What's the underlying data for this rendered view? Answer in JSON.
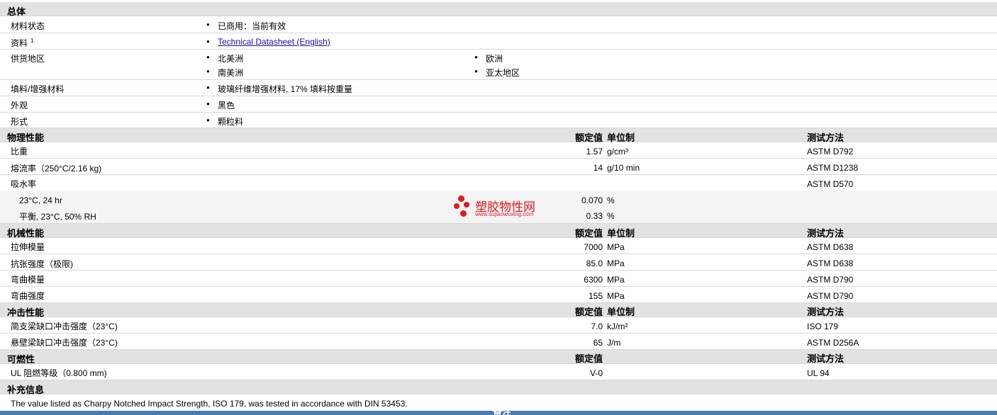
{
  "general": {
    "title": "总体",
    "material_status_label": "材料状态",
    "material_status_value": "已商用：当前有效",
    "docs_label": "资料",
    "docs_sup": "1",
    "docs_link": "Technical Datasheet (English)",
    "region_label": "供货地区",
    "regions": [
      "北美洲",
      "欧洲",
      "南美洲",
      "亚太地区"
    ],
    "filler_label": "填料/增强材料",
    "filler_value": "玻璃纤维增强材料, 17% 填料按重量",
    "appearance_label": "外观",
    "appearance_value": "黑色",
    "form_label": "形式",
    "form_value": "颗粒料"
  },
  "physical": {
    "title": "物理性能",
    "h_value": "额定值",
    "h_unit": "单位制",
    "h_test": "测试方法",
    "rows": [
      {
        "name": "比重",
        "value": "1.57",
        "unit": "g/cm³",
        "test": "ASTM D792"
      },
      {
        "name": "熔流率（250°C/2.16 kg)",
        "value": "14",
        "unit": "g/10 min",
        "test": "ASTM D1238"
      },
      {
        "name": "吸水率",
        "value": "",
        "unit": "",
        "test": "ASTM D570"
      },
      {
        "name": "23°C, 24 hr",
        "value": "0.070",
        "unit": "%",
        "test": ""
      },
      {
        "name": "平衡, 23°C, 50% RH",
        "value": "0.33",
        "unit": "%",
        "test": ""
      }
    ]
  },
  "mechanical": {
    "title": "机械性能",
    "h_value": "额定值",
    "h_unit": "单位制",
    "h_test": "测试方法",
    "rows": [
      {
        "name": "拉伸模量",
        "value": "7000",
        "unit": "MPa",
        "test": "ASTM D638"
      },
      {
        "name": "抗张强度（极限)",
        "value": "85.0",
        "unit": "MPa",
        "test": "ASTM D638"
      },
      {
        "name": "弯曲模量",
        "value": "6300",
        "unit": "MPa",
        "test": "ASTM D790"
      },
      {
        "name": "弯曲强度",
        "value": "155",
        "unit": "MPa",
        "test": "ASTM D790"
      }
    ]
  },
  "impact": {
    "title": "冲击性能",
    "h_value": "额定值",
    "h_unit": "单位制",
    "h_test": "测试方法",
    "rows": [
      {
        "name": "简支梁缺口冲击强度（23°C)",
        "value": "7.0",
        "unit": "kJ/m²",
        "test": "ISO 179"
      },
      {
        "name": "悬壁梁缺口冲击强度（23°C)",
        "value": "65",
        "unit": "J/m",
        "test": "ASTM D256A"
      }
    ]
  },
  "flammability": {
    "title": "可燃性",
    "h_value": "额定值",
    "h_test": "测试方法",
    "rows": [
      {
        "name": "UL 阻燃等级（0.800 mm)",
        "value": "V-0",
        "test": "UL 94"
      }
    ]
  },
  "supplement": {
    "title": "补充信息",
    "text": "The value listed as Charpy Notched Impact Strength, ISO 179, was tested in accordance with DIN 53453."
  },
  "watermark": {
    "name": "塑胶物性网",
    "url": "www.sujiaowuxing.com",
    "color": "#e3171f"
  },
  "footer_partial": "备注"
}
